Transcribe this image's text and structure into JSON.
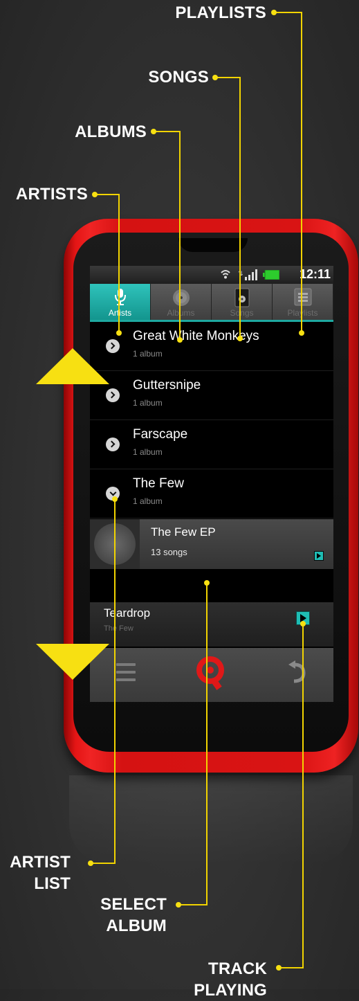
{
  "callouts": {
    "playlists": "PLAYLISTS",
    "songs": "SONGS",
    "albums": "ALBUMS",
    "artists": "ARTISTS",
    "artist_list_line1": "ARTIST",
    "artist_list_line2": "LIST",
    "select_album_line1": "SELECT",
    "select_album_line2": "ALBUM",
    "track_playing_line1": "TRACK",
    "track_playing_line2": "PLAYING"
  },
  "colors": {
    "accent": "#1ea9a1",
    "callout_yellow": "#f7e012",
    "phone_red": "#d91414"
  },
  "status_bar": {
    "time": "12:11",
    "icons": [
      "wifi-icon",
      "signal-icon",
      "battery-icon"
    ]
  },
  "tabs": [
    {
      "label": "Artists",
      "icon": "microphone-icon",
      "active": true
    },
    {
      "label": "Albums",
      "icon": "disc-icon",
      "active": false
    },
    {
      "label": "Songs",
      "icon": "music-note-icon",
      "active": false
    },
    {
      "label": "Playlists",
      "icon": "playlist-icon",
      "active": false
    }
  ],
  "artists": [
    {
      "name": "Great White Monkeys",
      "count": "1 album"
    },
    {
      "name": "Guttersnipe",
      "count": "1 album"
    },
    {
      "name": "Farscape",
      "count": "1 album"
    },
    {
      "name": "The Few",
      "count": "1 album"
    }
  ],
  "album": {
    "title": "The Few EP",
    "count": "13 songs"
  },
  "now_playing": {
    "title": "Teardrop",
    "artist": "The Few"
  },
  "bottom_bar": {
    "icons": [
      "menu-icon",
      "app-logo-icon",
      "back-icon"
    ]
  }
}
